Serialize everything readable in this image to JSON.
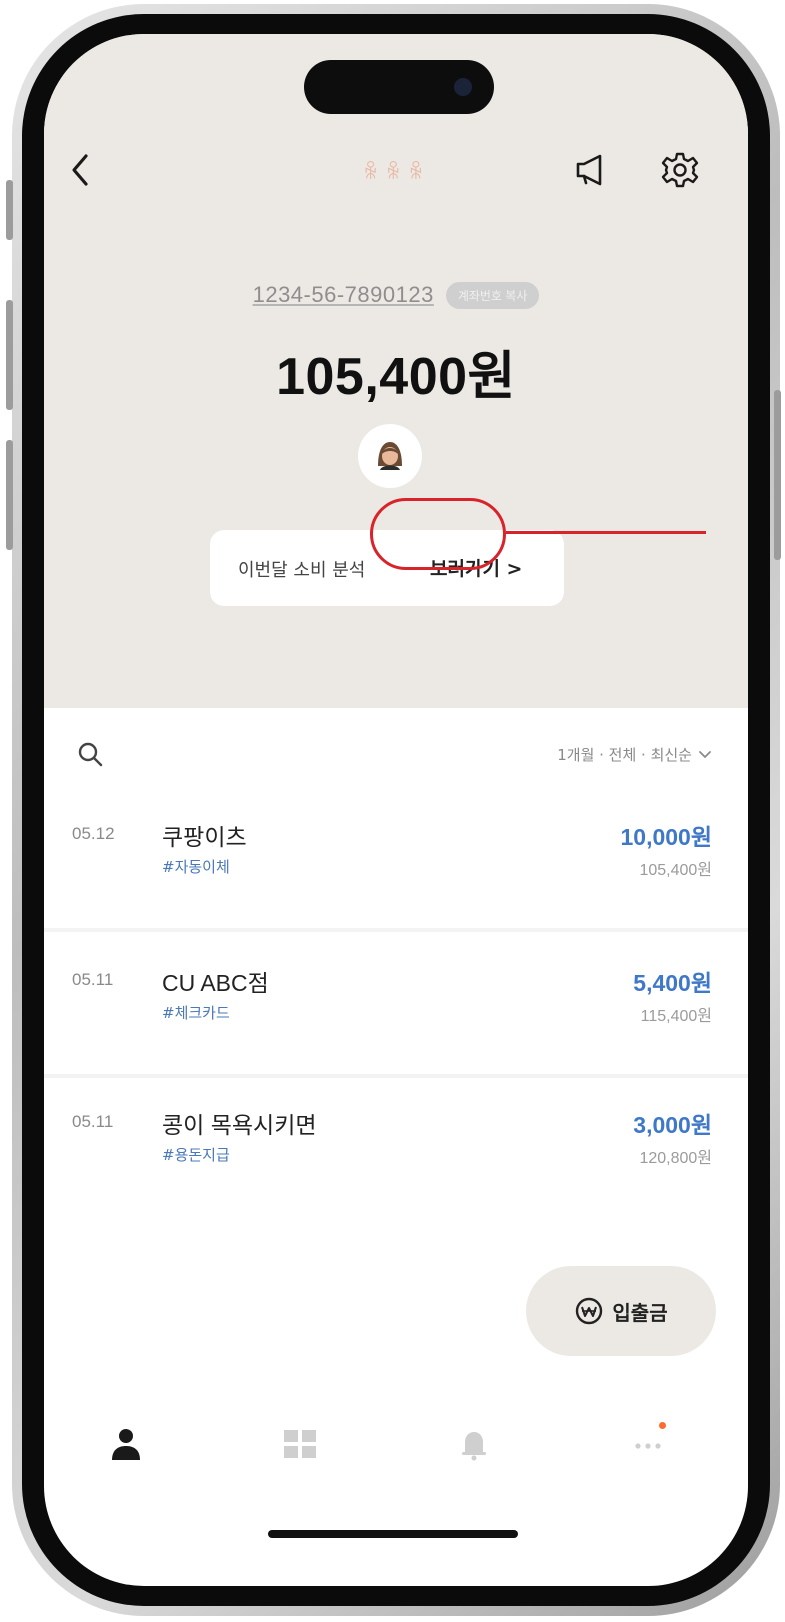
{
  "header": {
    "account_name_glyphs": [
      "ꆜ",
      "ꆜ",
      "ꆜ"
    ],
    "back_icon": "chevron-left-icon",
    "megaphone_icon": "megaphone-icon",
    "settings_icon": "gear-icon"
  },
  "account": {
    "number": "1234-56-7890123",
    "copy_badge": "계좌번호 복사",
    "balance": "105,400원",
    "avatar_icon": "memoji-avatar-icon"
  },
  "analysis": {
    "label": "이번달 소비 분석",
    "link": "보러가기 >"
  },
  "filter": {
    "text": "1개월 · 전체 · 최신순",
    "search_icon": "search-icon",
    "chevron_icon": "chevron-down-icon"
  },
  "transactions": [
    {
      "date": "05.12",
      "title": "쿠팡이츠",
      "tag": "#자동이체",
      "amount": "10,000원",
      "balance": "105,400원"
    },
    {
      "date": "05.11",
      "title": "CU ABC점",
      "tag": "#체크카드",
      "amount": "5,400원",
      "balance": "115,400원"
    },
    {
      "date": "05.11",
      "title": "콩이 목욕시키면",
      "tag": "#용돈지급",
      "amount": "3,000원",
      "balance": "120,800원"
    }
  ],
  "fab": {
    "label": "입출금",
    "icon": "won-coin-icon"
  },
  "tabs": [
    {
      "icon": "person-icon",
      "active": true
    },
    {
      "icon": "grid-icon",
      "active": false
    },
    {
      "icon": "bell-icon",
      "active": false
    },
    {
      "icon": "more-dots-icon",
      "active": false,
      "badge": true
    }
  ],
  "colors": {
    "accent_blue": "#3f78c7",
    "highlight_red": "#d8232a",
    "header_bg": "#ece9e4",
    "notification_dot": "#ff6a2e"
  }
}
